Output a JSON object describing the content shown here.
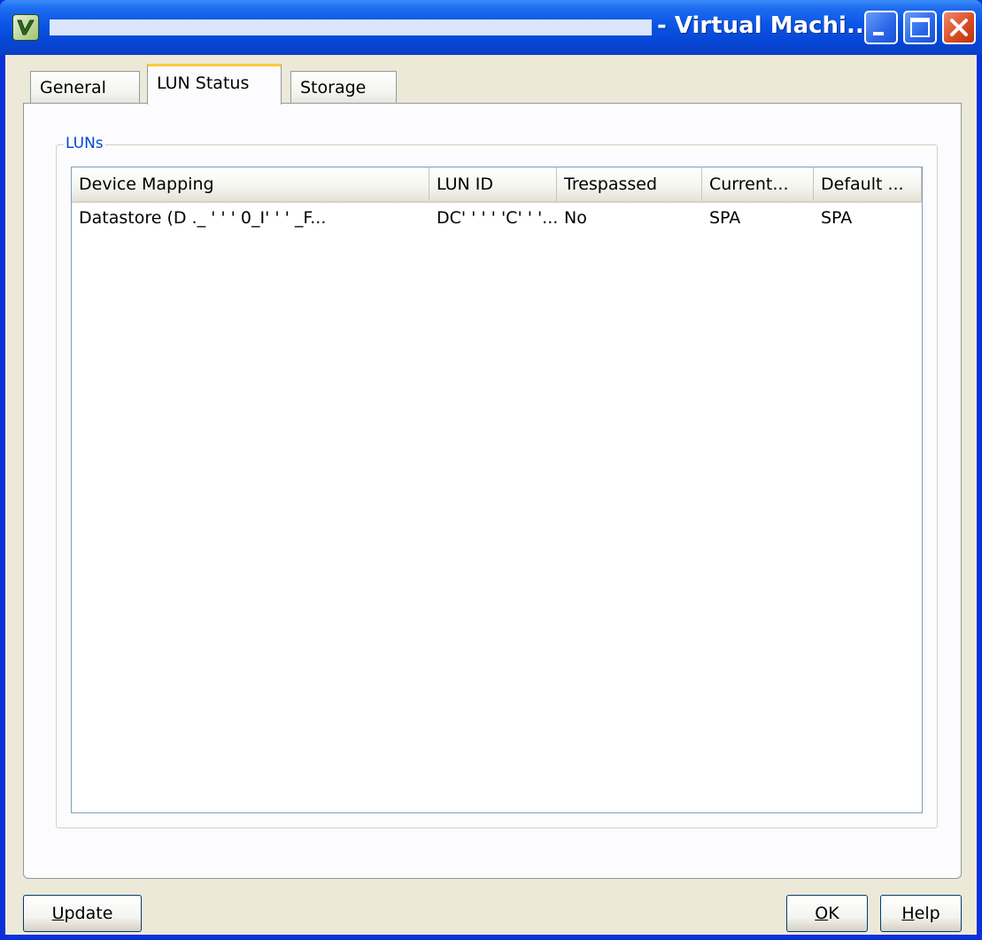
{
  "window": {
    "title": "- Virtual Machi...",
    "buttons": {
      "minimize": "minimize-icon",
      "maximize": "maximize-icon",
      "close": "close-icon"
    }
  },
  "tabs": [
    {
      "label": "General",
      "selected": false
    },
    {
      "label": "LUN Status",
      "selected": true
    },
    {
      "label": "Storage",
      "selected": false
    }
  ],
  "lun_group": {
    "label": "LUNs",
    "columns": [
      "Device Mapping",
      "LUN ID",
      "Trespassed",
      "Current...",
      "Default ..."
    ],
    "rows": [
      {
        "device_mapping": "Datastore (D  ._     ' ' ' 0_I' ' ' _F...",
        "lun_id": "DC' ' ' ' 'C' ' '...",
        "trespassed": "No",
        "current": "SPA",
        "default": "SPA"
      }
    ]
  },
  "footer": {
    "update_label": "Update",
    "update_hotkey": "U",
    "update_rest": "pdate",
    "ok_label": "OK",
    "ok_hotkey": "O",
    "ok_rest": "K",
    "help_label": "Help",
    "help_hotkey": "H",
    "help_rest": "elp"
  },
  "colors": {
    "titlebar": "#0a55e6",
    "client_bg": "#ece9d8",
    "group_label": "#0046d5",
    "selected_tab_accent": "#ffc83c"
  }
}
